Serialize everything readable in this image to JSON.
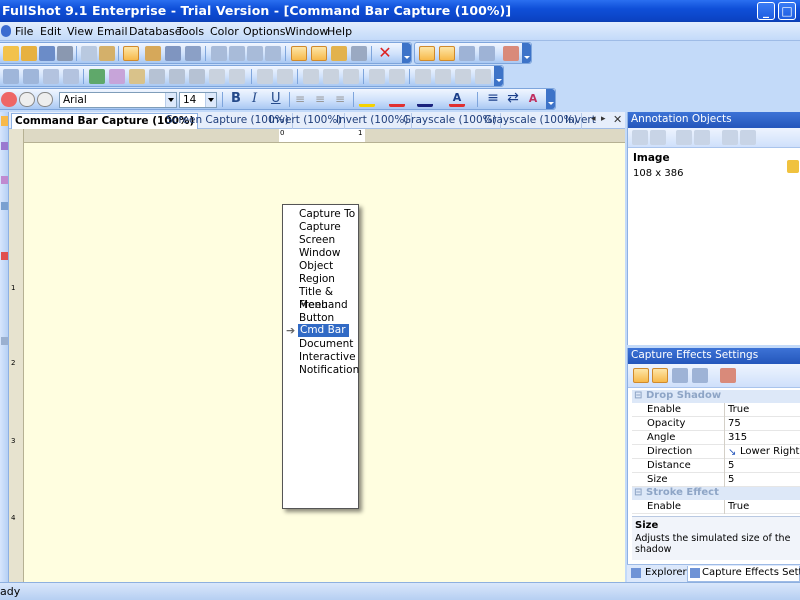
{
  "app": {
    "title": "FullShot 9.1 Enterprise - Trial Version - [Command Bar Capture (100%)]"
  },
  "menu": [
    "File",
    "Edit",
    "View",
    "Email",
    "Database",
    "Tools",
    "Color",
    "Options",
    "Window",
    "Help"
  ],
  "format_toolbar": {
    "font_name": "Arial",
    "font_size": "14",
    "bold": "B",
    "italic": "I",
    "underline": "U"
  },
  "tabs": [
    {
      "label": "Command Bar Capture (100%)",
      "active": true
    },
    {
      "label": "Screen Capture (100%)",
      "active": false
    },
    {
      "label": "Invert (100%)",
      "active": false
    },
    {
      "label": "Invert (100%)",
      "active": false
    },
    {
      "label": "Grayscale (100%)",
      "active": false
    },
    {
      "label": "Grayscale (100%)",
      "active": false
    },
    {
      "label": "Invert",
      "active": false
    }
  ],
  "ruler": {
    "h_labels": [
      "0",
      "1"
    ],
    "v_labels": [
      "1",
      "2",
      "3",
      "4"
    ]
  },
  "captured_menu": {
    "items": [
      "Capture To",
      "Capture",
      "Screen",
      "Window",
      "Object",
      "Region",
      "Title & Menu",
      "Freehand",
      "Button",
      "Cmd Bar",
      "Document",
      "Interactive",
      "Notification"
    ],
    "selected": "Cmd Bar"
  },
  "annotation_panel": {
    "title": "Annotation Objects",
    "object_name": "Image",
    "object_size": "108 x 386"
  },
  "effects_panel": {
    "title": "Capture Effects Settings",
    "categories": [
      {
        "name": "Drop Shadow",
        "rows": [
          {
            "key": "Enable",
            "value": "True"
          },
          {
            "key": "Opacity",
            "value": "75"
          },
          {
            "key": "Angle",
            "value": "315"
          },
          {
            "key": "Direction",
            "value": "Lower Right"
          },
          {
            "key": "Distance",
            "value": "5"
          },
          {
            "key": "Size",
            "value": "5"
          }
        ]
      },
      {
        "name": "Stroke Effect",
        "rows": [
          {
            "key": "Enable",
            "value": "True"
          }
        ]
      }
    ],
    "help_title": "Size",
    "help_text": "Adjusts the simulated size of the shadow"
  },
  "bottom_tabs": [
    "Explorer",
    "Capture Effects Settings"
  ],
  "status": {
    "text": "ady"
  }
}
